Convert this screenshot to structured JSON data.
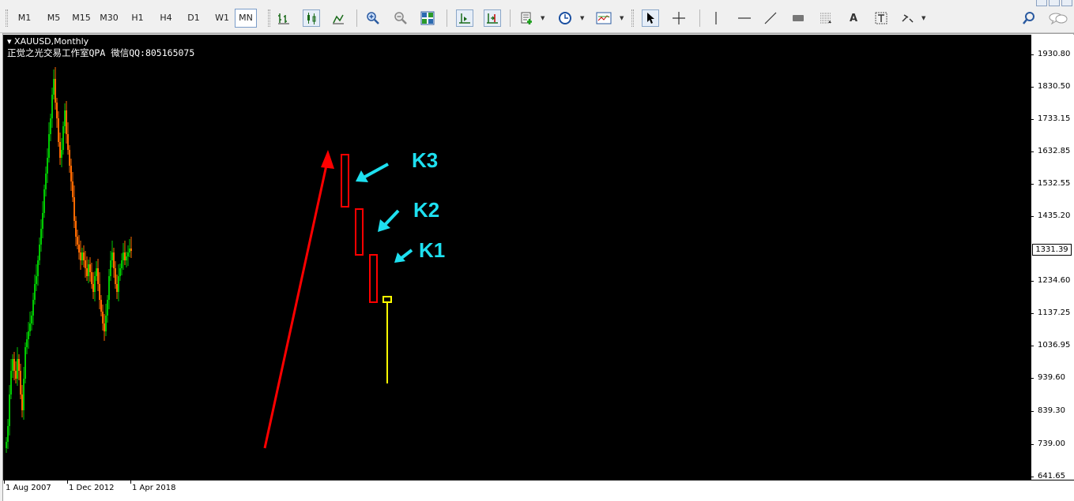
{
  "toolbar": {
    "timeframes": [
      "M1",
      "M5",
      "M15",
      "M30",
      "H1",
      "H4",
      "D1",
      "W1",
      "MN"
    ],
    "active_timeframe": "MN",
    "tools": [
      "bar-chart-icon",
      "candlestick-icon",
      "line-chart-icon",
      "zoom-in-icon",
      "zoom-out-icon",
      "tile-windows-icon",
      "chart-shift-icon",
      "autoscroll-icon",
      "indicators-icon",
      "periods-icon",
      "templates-icon",
      "cursor-icon",
      "crosshair-icon",
      "vertical-line-icon",
      "horizontal-line-icon",
      "trendline-icon",
      "rectangle-icon",
      "fibonacci-icon",
      "text-icon",
      "text-label-icon",
      "arrows-icon",
      "search-icon",
      "chat-icon"
    ]
  },
  "chart": {
    "symbol_title": "XAUUSD,Monthly",
    "subtitle": "正觉之光交易工作室QPA 微信QQ:805165075",
    "current_price": "1331.39",
    "price_labels": [
      "1930.80",
      "1830.50",
      "1733.15",
      "1632.85",
      "1532.55",
      "1435.20",
      "1234.60",
      "1137.25",
      "1036.95",
      "939.60",
      "839.30",
      "739.00",
      "641.65"
    ],
    "time_labels": [
      "1 Aug 2007",
      "1 Dec 2012",
      "1 Apr 2018"
    ],
    "annotations": {
      "k3": "K3",
      "k2": "K2",
      "k1": "K1"
    },
    "colors": {
      "background": "#000000",
      "bull": "#00c800",
      "bear": "#ff6a00",
      "arrow_red": "#ff0000",
      "arrow_cyan": "#1ee0f0",
      "box_red": "#ff0000",
      "yellow": "#ffff00"
    }
  }
}
